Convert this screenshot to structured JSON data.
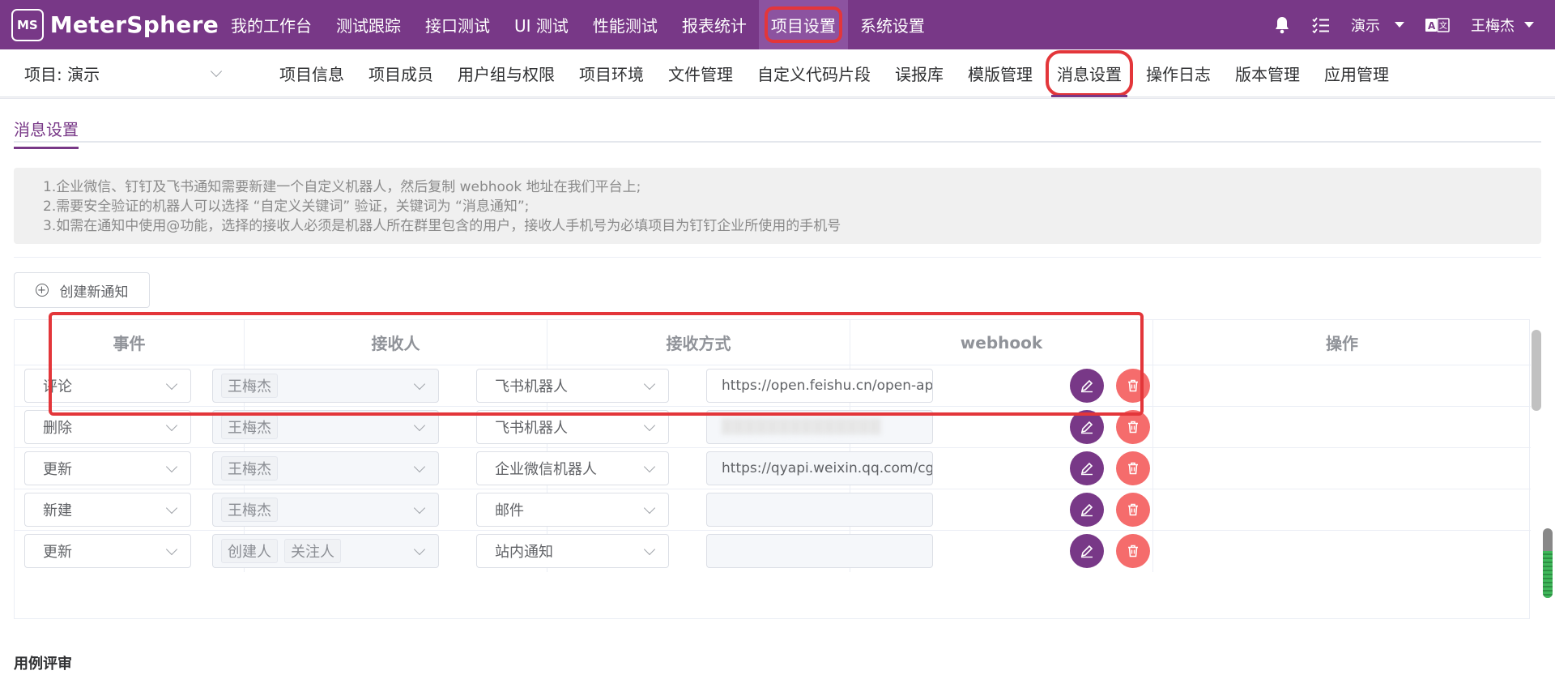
{
  "app": {
    "logo_mark": "MS",
    "logo_text": "MeterSphere"
  },
  "topnav": {
    "items": [
      {
        "label": "我的工作台",
        "active": false
      },
      {
        "label": "测试跟踪",
        "active": false
      },
      {
        "label": "接口测试",
        "active": false
      },
      {
        "label": "UI 测试",
        "active": false
      },
      {
        "label": "性能测试",
        "active": false
      },
      {
        "label": "报表统计",
        "active": false
      },
      {
        "label": "项目设置",
        "active": true
      },
      {
        "label": "系统设置",
        "active": false
      }
    ],
    "workspace": "演示",
    "user": "王梅杰",
    "icons": [
      "bell-icon",
      "checklist-icon",
      "chevron-down-icon",
      "translate-icon"
    ]
  },
  "subnav": {
    "project_label": "项目: 演示",
    "items": [
      {
        "label": "项目信息",
        "active": false
      },
      {
        "label": "项目成员",
        "active": false
      },
      {
        "label": "用户组与权限",
        "active": false
      },
      {
        "label": "项目环境",
        "active": false
      },
      {
        "label": "文件管理",
        "active": false
      },
      {
        "label": "自定义代码片段",
        "active": false
      },
      {
        "label": "误报库",
        "active": false
      },
      {
        "label": "模版管理",
        "active": false
      },
      {
        "label": "消息设置",
        "active": true
      },
      {
        "label": "操作日志",
        "active": false
      },
      {
        "label": "版本管理",
        "active": false
      },
      {
        "label": "应用管理",
        "active": false
      }
    ]
  },
  "main": {
    "tab": "消息设置",
    "tips": [
      "1.企业微信、钉钉及飞书通知需要新建一个自定义机器人，然后复制 webhook 地址在我们平台上;",
      "2.需要安全验证的机器人可以选择 “自定义关键词” 验证，关键词为 “消息通知”;",
      "3.如需在通知中使用@功能，选择的接收人必须是机器人所在群里包含的用户，接收人手机号为必填项目为钉钉企业所使用的手机号"
    ],
    "create_button": "创建新通知",
    "table": {
      "headers": {
        "event": "事件",
        "receivers": "接收人",
        "method": "接收方式",
        "webhook": "webhook",
        "actions": "操作"
      },
      "rows": [
        {
          "event": "评论",
          "receivers": [
            "王梅杰"
          ],
          "method": "飞书机器人",
          "webhook": "https://open.feishu.cn/open-apis/bot/v",
          "webhook_state": "editable"
        },
        {
          "event": "删除",
          "receivers": [
            "王梅杰"
          ],
          "method": "飞书机器人",
          "webhook": "",
          "webhook_state": "blurred"
        },
        {
          "event": "更新",
          "receivers": [
            "王梅杰"
          ],
          "method": "企业微信机器人",
          "webhook": "https://qyapi.weixin.qq.com/cgi-bin/we",
          "webhook_state": "disabled"
        },
        {
          "event": "新建",
          "receivers": [
            "王梅杰"
          ],
          "method": "邮件",
          "webhook": "",
          "webhook_state": "disabled"
        },
        {
          "event": "更新",
          "receivers": [
            "创建人",
            "关注人"
          ],
          "method": "站内通知",
          "webhook": "",
          "webhook_state": "disabled"
        }
      ]
    },
    "next_section_title": "用例评审"
  },
  "colors": {
    "brand": "#783887",
    "delete": "#f56c6c",
    "highlight": "#e3363a"
  }
}
